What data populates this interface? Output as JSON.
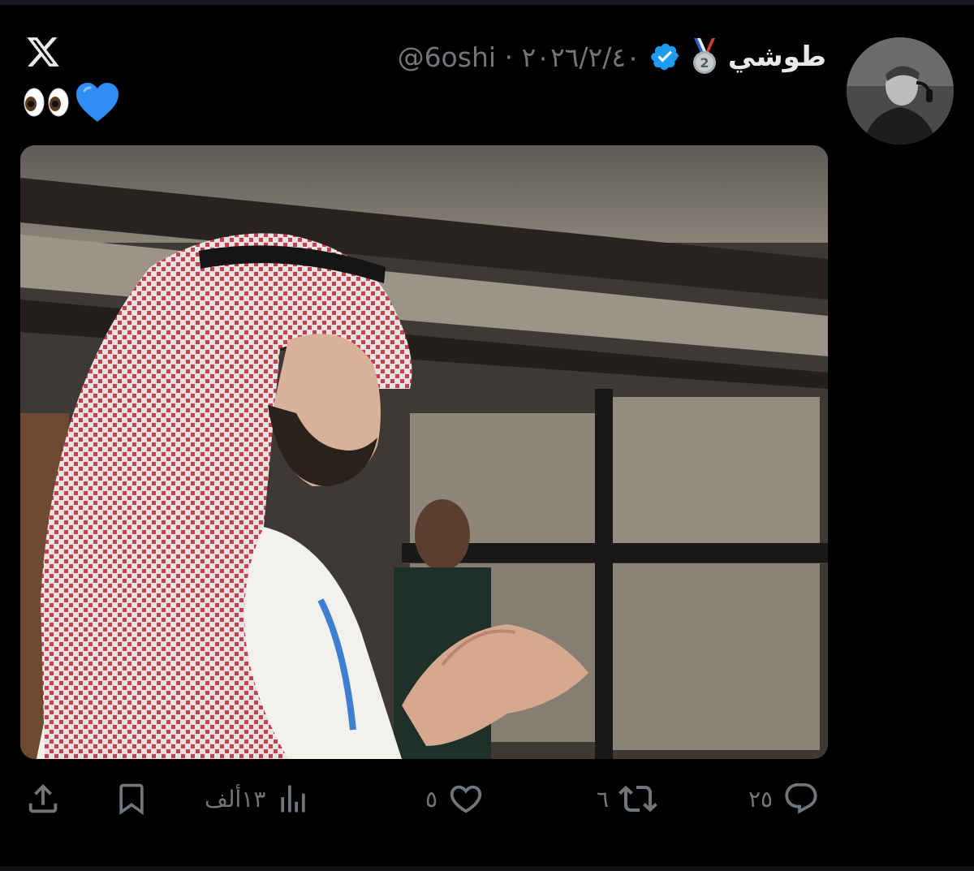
{
  "tweet": {
    "display_name": "طوشي",
    "handle_date": "@6oshi · ٢٠٢٦/٢/٤٠",
    "text_emoji": "👀💙",
    "media_alt": "man in red and white shemagh clapping"
  },
  "icons": {
    "medal": "second-place-medal-icon",
    "verified": "verified-badge-icon",
    "x_logo": "x-logo-icon",
    "reply": "reply-icon",
    "retweet": "retweet-icon",
    "like": "like-icon",
    "views": "views-icon",
    "bookmark": "bookmark-icon",
    "share": "share-icon"
  },
  "actions": {
    "replies": "٢٥",
    "retweets": "٦",
    "likes": "٥",
    "views": "١٣ألف"
  },
  "colors": {
    "background": "#000000",
    "text_primary": "#e7e9ea",
    "text_secondary": "#71767b",
    "verified_blue": "#1d9bf0"
  }
}
